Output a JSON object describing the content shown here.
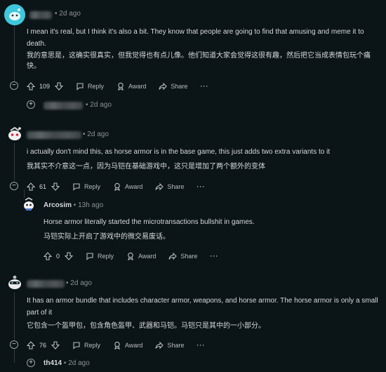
{
  "comments": [
    {
      "time": "2d ago",
      "text_en": "I mean it's real, but I think it's also a bit. They know that people are going to find that amusing and meme it to death.",
      "text_zh": "我的意思是，这确实很真实，但我觉得也有点儿像。他们知道大家会觉得这很有趣，然后把它当成表情包玩个痛快。",
      "votes": "109"
    },
    {
      "time": "2d ago",
      "text_en": "i actually don't mind this, as horse armor is in the base game, this just adds two extra variants to it",
      "text_zh": "我其实不介意这一点，因为马铠在基础游戏中，这只是增加了两个额外的变体",
      "votes": "61"
    },
    {
      "author": "Arcosim",
      "time": "13h ago",
      "text_en": "Horse armor literally started the microtransactions bullshit in games.",
      "text_zh": "马铠实际上开启了游戏中的微交易废话。",
      "votes": "0"
    },
    {
      "time": "2d ago",
      "text_en": "It has an armor bundle that includes character armor, weapons, and horse armor. The horse armor is only a small part of it",
      "text_zh": "它包含一个盔甲包，包含角色盔甲、武器和马铠。马铠只是其中的一小部分。",
      "votes": "76"
    }
  ],
  "collapsed": [
    {
      "time": "2d ago"
    },
    {
      "author": "th414",
      "time": "2d ago"
    }
  ],
  "actions": {
    "reply": "Reply",
    "award": "Award",
    "share": "Share",
    "more": "···"
  },
  "symbols": {
    "sep": "•",
    "plus": "+",
    "minus": "−"
  },
  "colors": {
    "background": "#0b1416",
    "text": "#d7dadc",
    "muted": "#8b9296",
    "thread_line": "#343b3f"
  },
  "icons": [
    "upvote-icon",
    "downvote-icon",
    "reply-icon",
    "award-icon",
    "share-icon",
    "expand-icon",
    "collapse-icon"
  ]
}
